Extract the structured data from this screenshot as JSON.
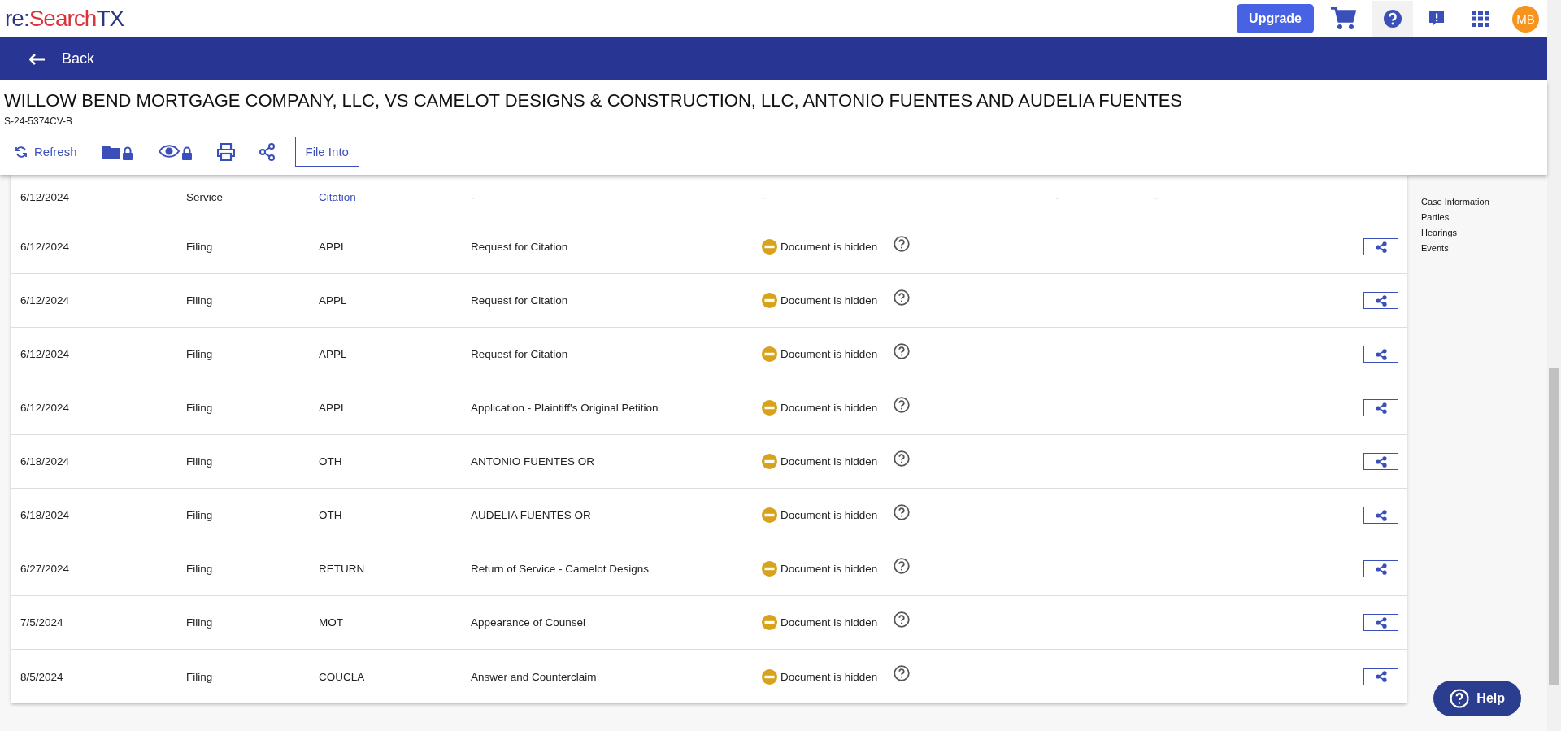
{
  "header": {
    "logo": {
      "prefix": "re:",
      "middle": "Search",
      "suffix": "TX"
    },
    "upgrade": "Upgrade",
    "avatar": "MB"
  },
  "nav_bar": {
    "back": "Back"
  },
  "case": {
    "title": "WILLOW BEND MORTGAGE COMPANY, LLC, VS CAMELOT DESIGNS & CONSTRUCTION, LLC, ANTONIO FUENTES AND AUDELIA FUENTES",
    "number": "S-24-5374CV-B",
    "toolbar": {
      "refresh": "Refresh",
      "file_into": "File Into"
    }
  },
  "events": [
    {
      "kind": "service",
      "date": "6/12/2024",
      "type": "Service",
      "code": "Citation",
      "description": "-",
      "document": "-",
      "column_7": "-",
      "column_8": "-"
    },
    {
      "kind": "filing",
      "date": "6/12/2024",
      "type": "Filing",
      "code": "APPL",
      "description": "Request for Citation",
      "document": "Document is hidden"
    },
    {
      "kind": "filing",
      "date": "6/12/2024",
      "type": "Filing",
      "code": "APPL",
      "description": "Request for Citation",
      "document": "Document is hidden"
    },
    {
      "kind": "filing",
      "date": "6/12/2024",
      "type": "Filing",
      "code": "APPL",
      "description": "Request for Citation",
      "document": "Document is hidden"
    },
    {
      "kind": "filing",
      "date": "6/12/2024",
      "type": "Filing",
      "code": "APPL",
      "description": "Application - Plaintiff's Original Petition",
      "document": "Document is hidden"
    },
    {
      "kind": "filing",
      "date": "6/18/2024",
      "type": "Filing",
      "code": "OTH",
      "description": "ANTONIO FUENTES OR",
      "document": "Document is hidden"
    },
    {
      "kind": "filing",
      "date": "6/18/2024",
      "type": "Filing",
      "code": "OTH",
      "description": "AUDELIA FUENTES OR",
      "document": "Document is hidden"
    },
    {
      "kind": "filing",
      "date": "6/27/2024",
      "type": "Filing",
      "code": "RETURN",
      "description": "Return of Service - Camelot Designs",
      "document": "Document is hidden"
    },
    {
      "kind": "filing",
      "date": "7/5/2024",
      "type": "Filing",
      "code": "MOT",
      "description": "Appearance of Counsel",
      "document": "Document is hidden"
    },
    {
      "kind": "filing",
      "date": "8/5/2024",
      "type": "Filing",
      "code": "COUCLA",
      "description": "Answer and Counterclaim",
      "document": "Document is hidden"
    }
  ],
  "side_nav": [
    "Case Information",
    "Parties",
    "Hearings",
    "Events"
  ],
  "help_button": "Help"
}
